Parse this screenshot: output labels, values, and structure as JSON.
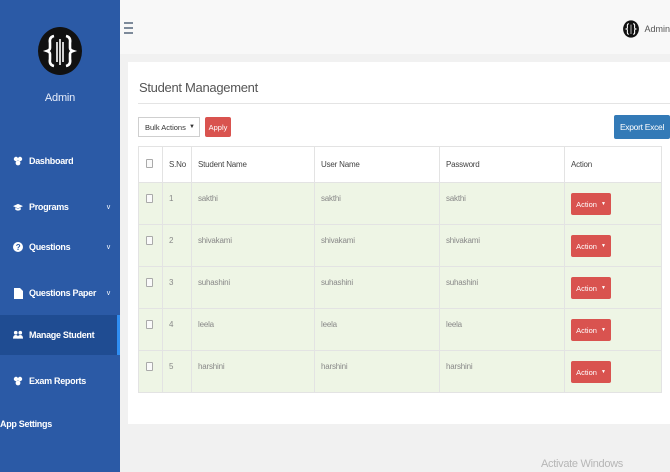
{
  "sidebar": {
    "admin_name": "Admin",
    "items": [
      {
        "label": "Dashboard",
        "icon": "dashboard-icon",
        "chevron": ""
      },
      {
        "label": "Programs",
        "icon": "graduation-cap-icon",
        "chevron": "v"
      },
      {
        "label": "Questions",
        "icon": "question-icon",
        "chevron": "v"
      },
      {
        "label": "Questions Paper",
        "icon": "file-icon",
        "chevron": "v"
      },
      {
        "label": "Manage Student",
        "icon": "users-icon",
        "chevron": "",
        "active": true
      },
      {
        "label": "Exam Reports",
        "icon": "reports-icon",
        "chevron": ""
      },
      {
        "label": "App Settings",
        "icon": "",
        "chevron": ""
      }
    ]
  },
  "topbar": {
    "user_label": "Admin"
  },
  "panel": {
    "title": "Student Management",
    "bulk_actions": "Bulk Actions",
    "apply_label": "Apply",
    "export_label": "Export Excel"
  },
  "table": {
    "headers": [
      "S.No",
      "Student Name",
      "User Name",
      "Password",
      "Action"
    ],
    "rows": [
      {
        "sno": "1",
        "student_name": "sakthi",
        "user_name": "sakthi",
        "password": "sakthi",
        "action": "Action"
      },
      {
        "sno": "2",
        "student_name": "shivakami",
        "user_name": "shivakami",
        "password": "shivakami",
        "action": "Action"
      },
      {
        "sno": "3",
        "student_name": "suhashini",
        "user_name": "suhashini",
        "password": "suhashini",
        "action": "Action"
      },
      {
        "sno": "4",
        "student_name": "leela",
        "user_name": "leela",
        "password": "leela",
        "action": "Action"
      },
      {
        "sno": "5",
        "student_name": "harshini",
        "user_name": "harshini",
        "password": "harshini",
        "action": "Action"
      }
    ]
  },
  "watermark": "Activate Windows",
  "colors": {
    "sidebar": "#2b5aa6",
    "danger": "#d9534f",
    "primary": "#337ab7",
    "row_highlight": "#eef5e5"
  }
}
